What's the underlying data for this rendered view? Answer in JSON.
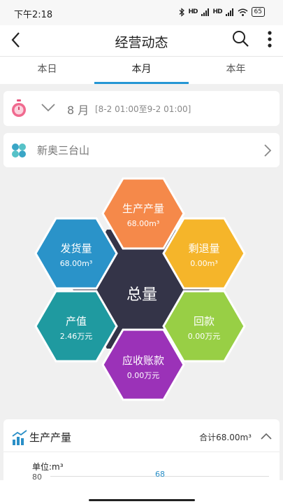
{
  "status_bar": {
    "time": "下午2:18",
    "signal_1": "HD",
    "signal_2": "HD",
    "battery": "65"
  },
  "header": {
    "title": "经营动态"
  },
  "tabs": [
    {
      "label": "本日",
      "active": false
    },
    {
      "label": "本月",
      "active": true
    },
    {
      "label": "本年",
      "active": false
    }
  ],
  "date_filter": {
    "month": "8 月",
    "range": "[8-2 01:00至9-2 01:00]"
  },
  "site": {
    "name": "新奥三台山"
  },
  "summary": {
    "center_label": "总量",
    "tiles": [
      {
        "name": "生产产量",
        "value": "68.00m³",
        "color": "#f5894a"
      },
      {
        "name": "剩退量",
        "value": "0.00m³",
        "color": "#f5b52a"
      },
      {
        "name": "回款",
        "value": "0.00万元",
        "color": "#98cf45"
      },
      {
        "name": "应收账款",
        "value": "0.00万元",
        "color": "#9b32b8"
      },
      {
        "name": "产值",
        "value": "2.46万元",
        "color": "#1f9aa0"
      },
      {
        "name": "发货量",
        "value": "68.00m³",
        "color": "#2a93c9"
      }
    ]
  },
  "chart_section": {
    "title": "生产产量",
    "total": "合计68.00m³",
    "unit": "单位:m³",
    "tick": "80",
    "data_label": "68"
  }
}
